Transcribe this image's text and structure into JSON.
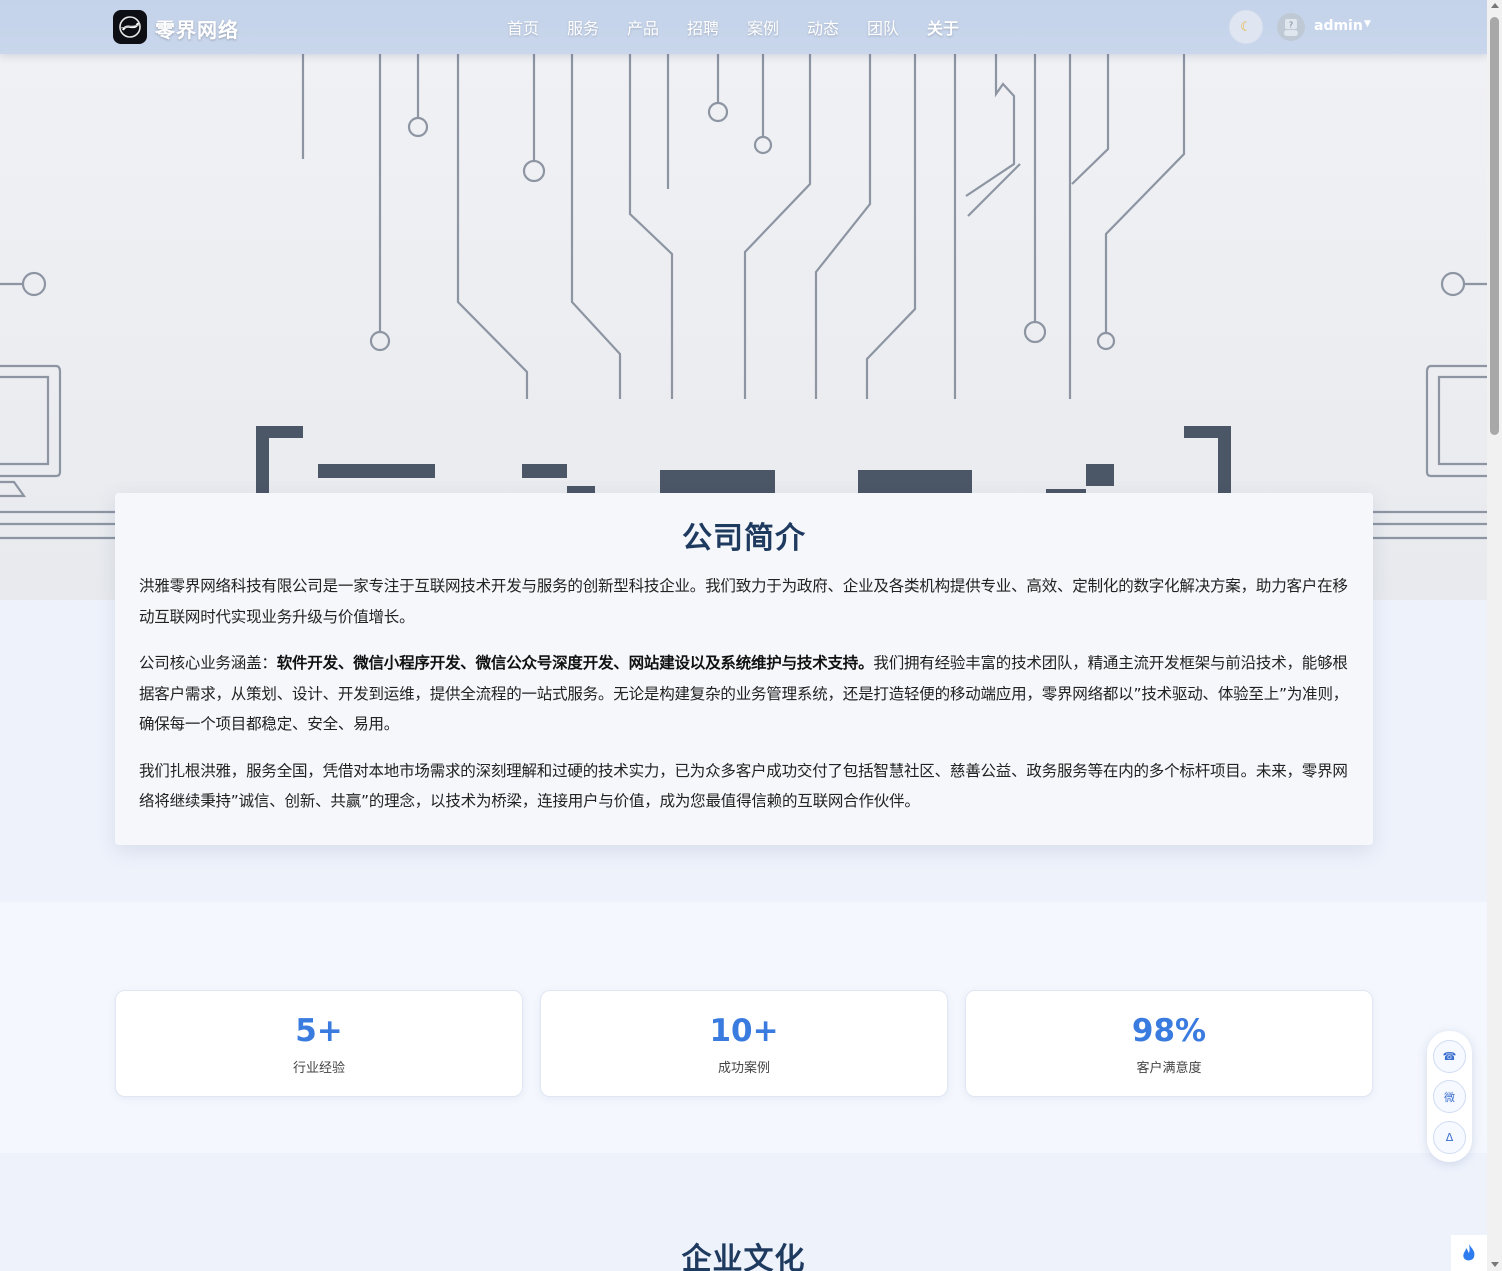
{
  "brand": {
    "name": "零界网络",
    "logo_icon": "logo-s-icon"
  },
  "nav": {
    "items": [
      {
        "label": "首页"
      },
      {
        "label": "服务"
      },
      {
        "label": "产品"
      },
      {
        "label": "招聘"
      },
      {
        "label": "案例"
      },
      {
        "label": "动态"
      },
      {
        "label": "团队"
      },
      {
        "label": "关于"
      }
    ],
    "active_index": 7
  },
  "user": {
    "name": "admin",
    "theme_icon": "moon-icon"
  },
  "intro": {
    "title": "公司简介",
    "p1": "洪雅零界网络科技有限公司是一家专注于互联网技术开发与服务的创新型科技企业。我们致力于为政府、企业及各类机构提供专业、高效、定制化的数字化解决方案，助力客户在移动互联网时代实现业务升级与价值增长。",
    "p2_prefix": "公司核心业务涵盖：",
    "p2_bold": "软件开发、微信小程序开发、微信公众号深度开发、网站建设以及系统维护与技术支持。",
    "p2_rest": "我们拥有经验丰富的技术团队，精通主流开发框架与前沿技术，能够根据客户需求，从策划、设计、开发到运维，提供全流程的一站式服务。无论是构建复杂的业务管理系统，还是打造轻便的移动端应用，零界网络都以”技术驱动、体验至上”为准则，确保每一个项目都稳定、安全、易用。",
    "p3": "我们扎根洪雅，服务全国，凭借对本地市场需求的深刻理解和过硬的技术实力，已为众多客户成功交付了包括智慧社区、慈善公益、政务服务等在内的多个标杆项目。未来，零界网络将继续秉持”诚信、创新、共赢”的理念，以技术为桥梁，连接用户与价值，成为您最值得信赖的互联网合作伙伴。"
  },
  "stats": [
    {
      "value": "5+",
      "label": "行业经验"
    },
    {
      "value": "10+",
      "label": "成功案例"
    },
    {
      "value": "98%",
      "label": "客户满意度"
    }
  ],
  "culture": {
    "title": "企业文化"
  },
  "side_tools": {
    "phone": "☎",
    "wechat": "微",
    "top": "ᐃ"
  },
  "colors": {
    "accent": "#3a7be0",
    "title": "#1f3a5f",
    "navbar": "#c4d3ea"
  }
}
